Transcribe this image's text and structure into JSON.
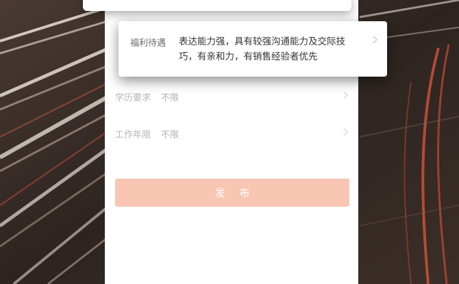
{
  "form": {
    "welfare": {
      "label": "福利待遇",
      "value": "表达能力强，具有较强沟通能力及交际技巧，有亲和力，有销售经验者优先"
    },
    "education": {
      "label": "学历要求",
      "value": "不限"
    },
    "experience": {
      "label": "工作年限",
      "value": "不限"
    },
    "publish_label": "发 布"
  },
  "icons": {
    "row_chevron": "chevron-right-icon"
  },
  "colors": {
    "publish_button": "#f8c6b2",
    "card_background": "#ffffff",
    "label_text": "#b5b5b5"
  }
}
